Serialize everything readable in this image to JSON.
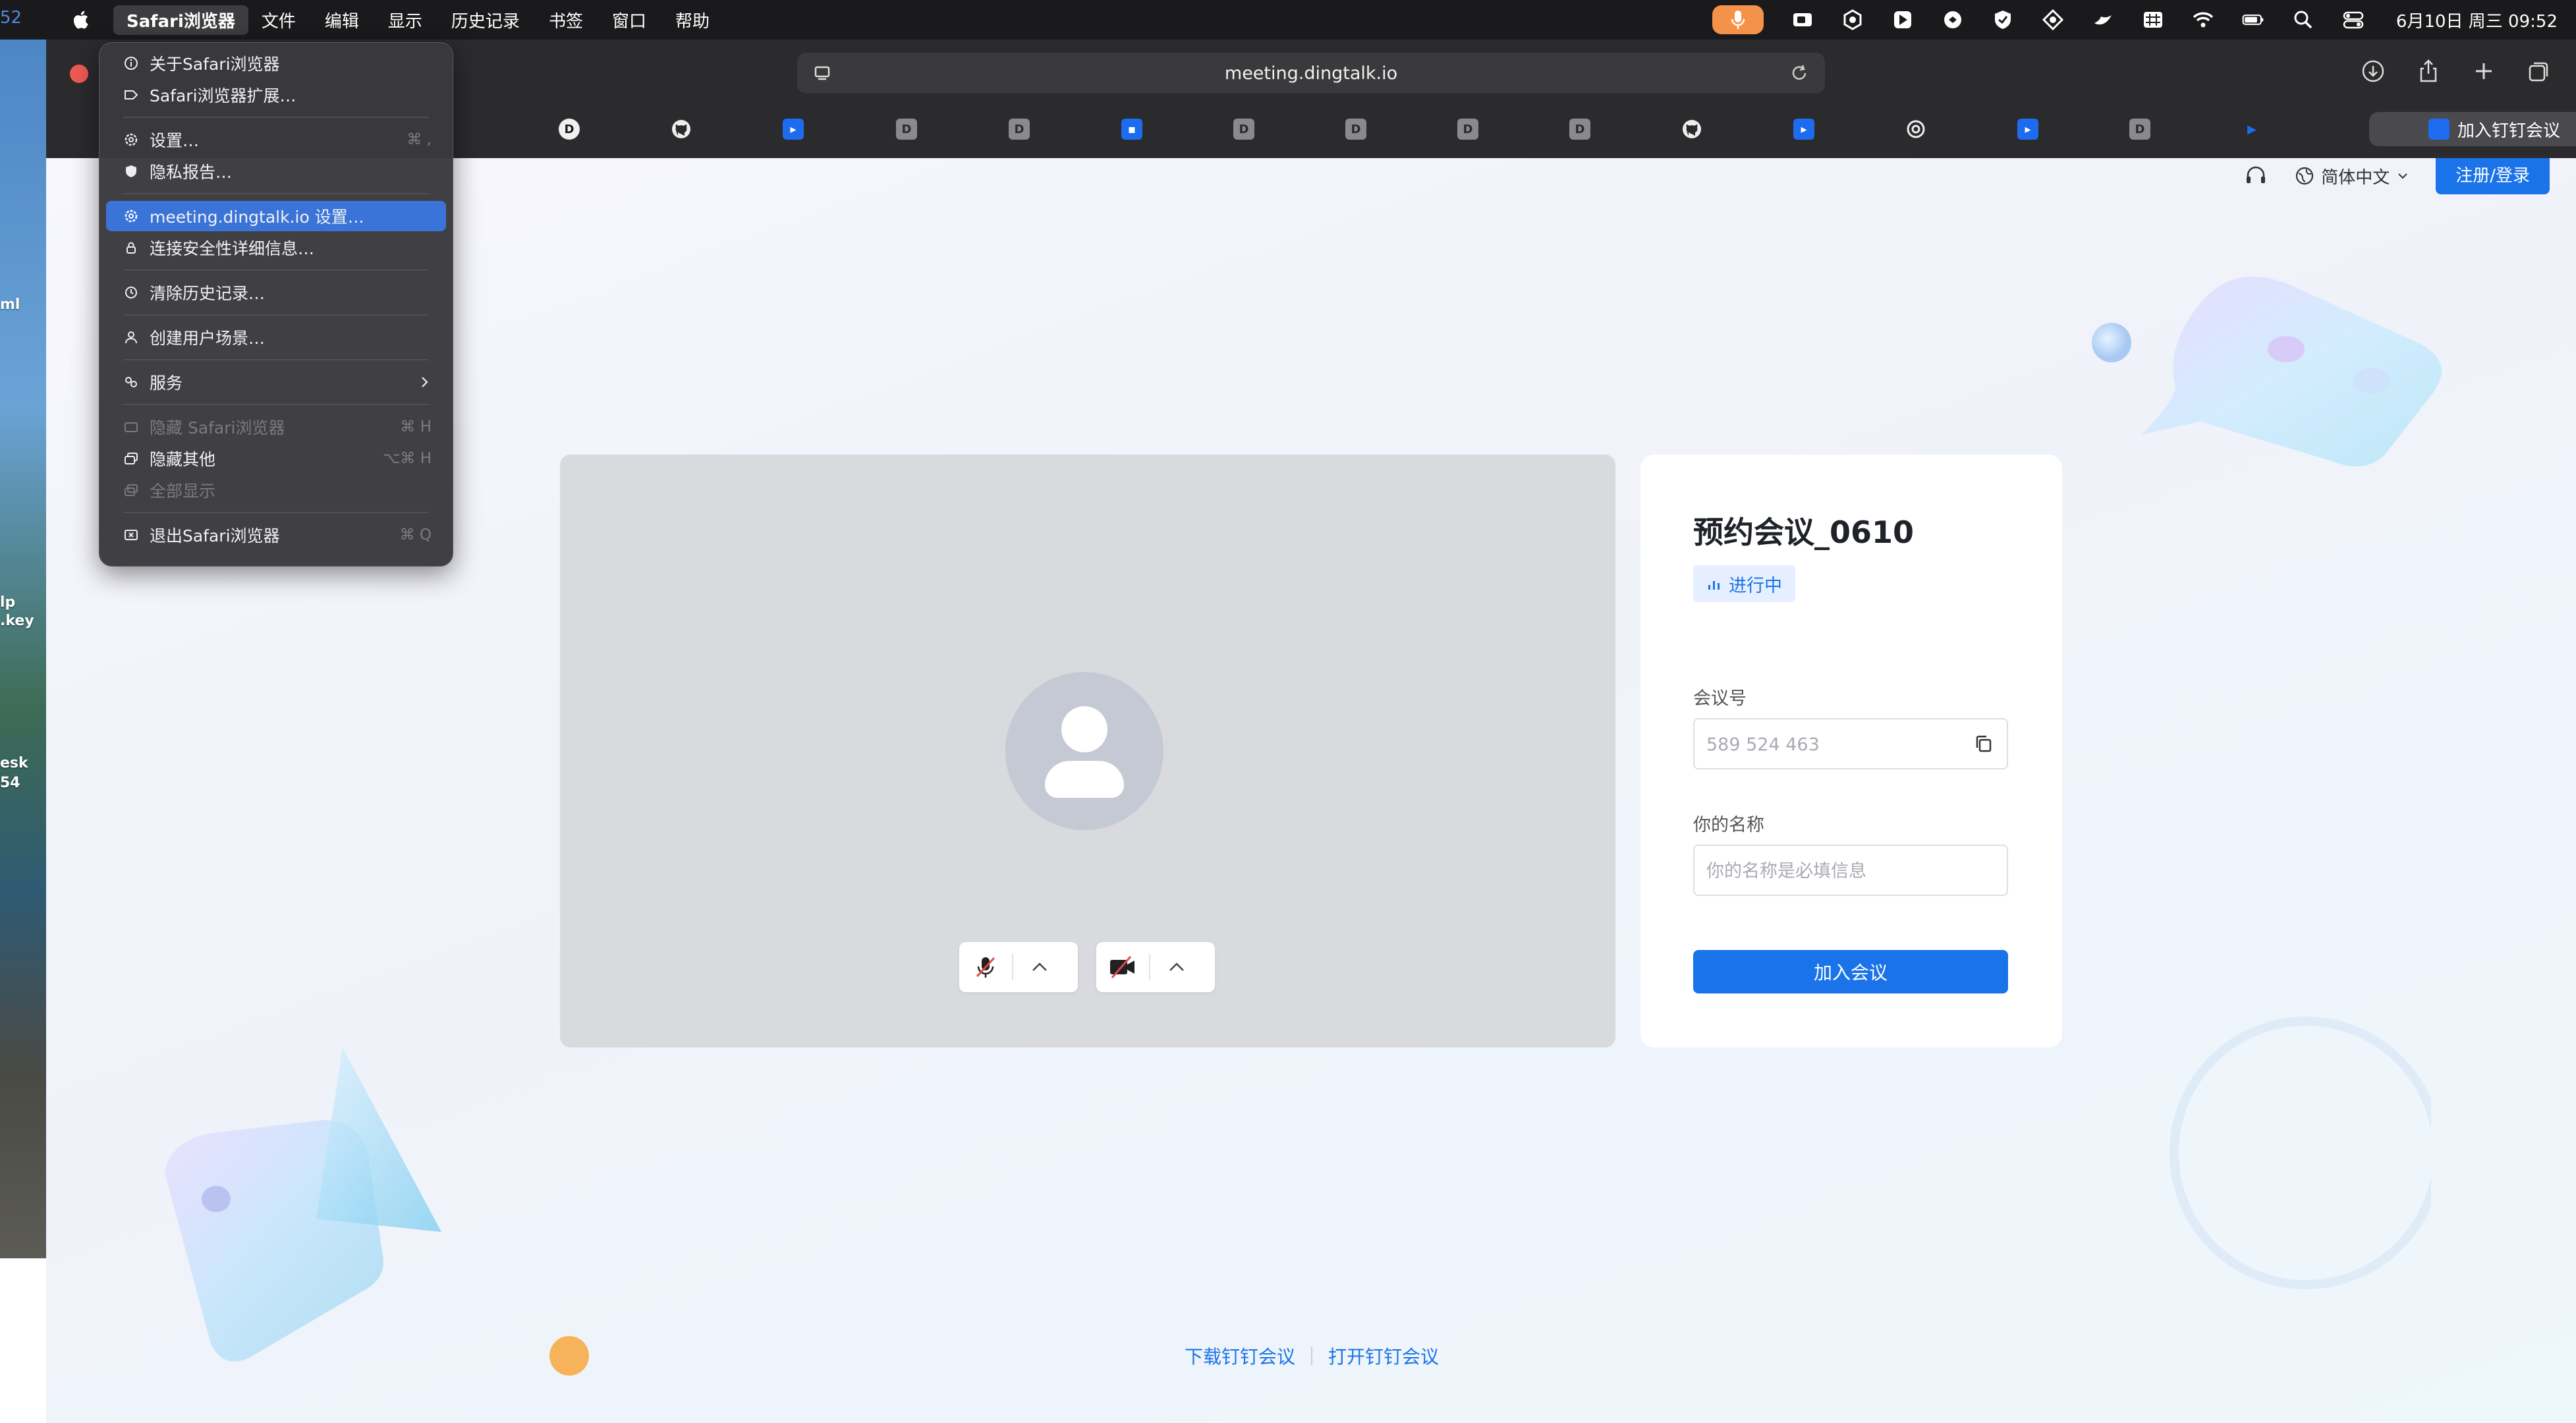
{
  "menubar": {
    "edge_time": "52",
    "app_name": "Safari浏览器",
    "items": [
      "文件",
      "编辑",
      "显示",
      "历史记录",
      "书签",
      "窗口",
      "帮助"
    ],
    "clock": "6月10日 周三 09:52"
  },
  "desktop": {
    "labels": [
      "ml",
      "lp",
      ".key",
      "esk",
      "54"
    ]
  },
  "browser": {
    "url": "meeting.dingtalk.io",
    "active_tab_title": "加入钉钉会议",
    "tab_letter": "D"
  },
  "dropdown": {
    "items": [
      {
        "label": "关于Safari浏览器",
        "shortcut": "",
        "icon": "info-icon"
      },
      {
        "label": "Safari浏览器扩展…",
        "shortcut": "",
        "icon": "extension-icon"
      },
      {
        "label": "设置…",
        "shortcut": "⌘ ,",
        "icon": "gear-icon"
      },
      {
        "label": "隐私报告…",
        "shortcut": "",
        "icon": "shield-icon"
      },
      {
        "label": "meeting.dingtalk.io 设置…",
        "shortcut": "",
        "icon": "gear-icon"
      },
      {
        "label": "连接安全性详细信息…",
        "shortcut": "",
        "icon": "lock-icon"
      },
      {
        "label": "清除历史记录…",
        "shortcut": "",
        "icon": "history-icon"
      },
      {
        "label": "创建用户场景…",
        "shortcut": "",
        "icon": "person-icon"
      },
      {
        "label": "服务",
        "shortcut": "",
        "icon": "services-icon"
      },
      {
        "label": "隐藏 Safari浏览器",
        "shortcut": "⌘ H",
        "icon": "hide-icon"
      },
      {
        "label": "隐藏其他",
        "shortcut": "⌥⌘ H",
        "icon": "hide-others-icon"
      },
      {
        "label": "全部显示",
        "shortcut": "",
        "icon": "show-all-icon"
      },
      {
        "label": "退出Safari浏览器",
        "shortcut": "⌘ Q",
        "icon": "quit-icon"
      }
    ]
  },
  "page": {
    "lang": "简体中文",
    "login": "注册/登录",
    "meeting_title": "预约会议_0610",
    "status": "进行中",
    "meeting_id_label": "会议号",
    "meeting_id_value": "589 524 463",
    "name_label": "你的名称",
    "name_placeholder": "你的名称是必填信息",
    "join_button": "加入会议",
    "footer": {
      "download": "下载钉钉会议",
      "open": "打开钉钉会议"
    }
  },
  "colors": {
    "accent": "#1a73e8",
    "menu_highlight": "#3a74d9",
    "mic_indicator": "#f5924a"
  }
}
